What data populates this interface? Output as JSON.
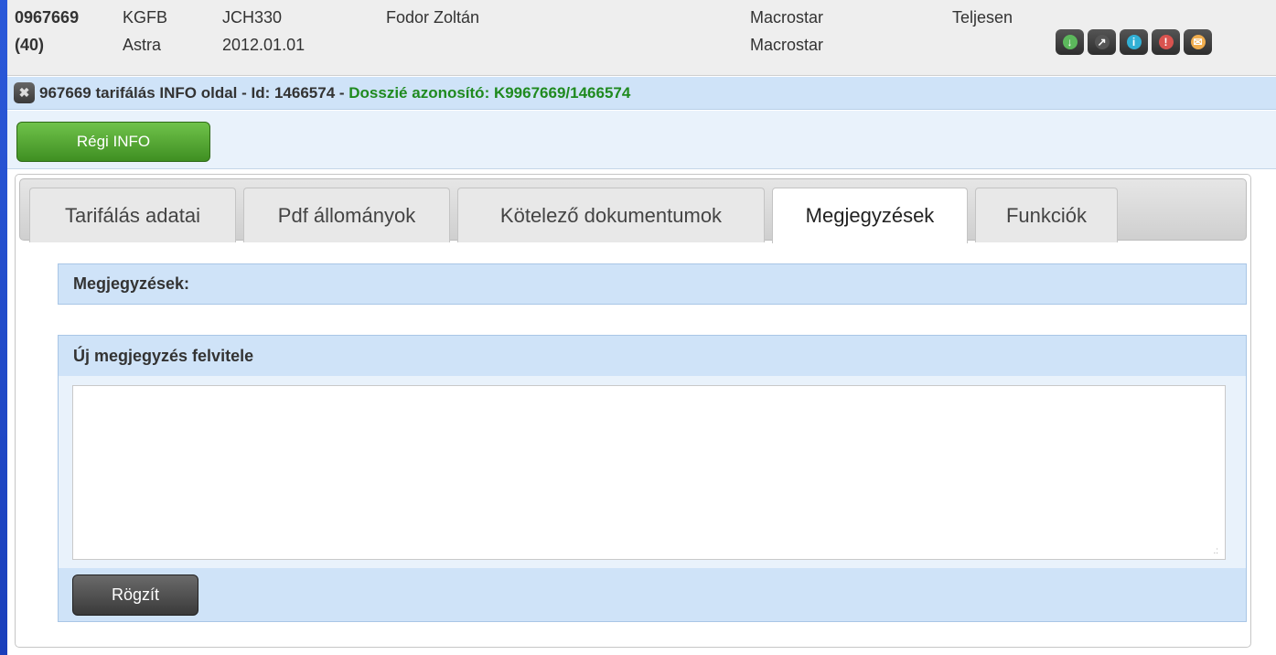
{
  "header": {
    "policy_number": "0967669",
    "policy_count": "(40)",
    "product": "KGFB",
    "vehicle_make": "Astra",
    "plate": "JCH330",
    "date": "2012.01.01",
    "client_name": "Fodor Zoltán",
    "agent_1": "Macrostar",
    "agent_2": "Macrostar",
    "status": "Teljesen",
    "icons": [
      {
        "name": "download-icon",
        "glyph": "↓",
        "color": "#5cb85c"
      },
      {
        "name": "external-link-icon",
        "glyph": "↗",
        "color": "#555555"
      },
      {
        "name": "info-icon",
        "glyph": "i",
        "color": "#31b0d5"
      },
      {
        "name": "alert-icon",
        "glyph": "!",
        "color": "#d9534f"
      },
      {
        "name": "mail-icon",
        "glyph": "✉",
        "color": "#f0ad4e"
      }
    ]
  },
  "titlebar": {
    "close_glyph": "✖",
    "title": "967669 tarifálás INFO oldal - Id: 1466574 - ",
    "dossier": "Dosszié azonosító: K9967669/1466574"
  },
  "actions": {
    "regi_info_label": "Régi INFO"
  },
  "tabs": [
    {
      "label": "Tarifálás adatai"
    },
    {
      "label": "Pdf állományok"
    },
    {
      "label": "Kötelező dokumentumok"
    },
    {
      "label": "Megjegyzések",
      "active": true
    },
    {
      "label": "Funkciók"
    }
  ],
  "notes": {
    "section_title": "Megjegyzések:",
    "new_note_title": "Új megjegyzés felvitele",
    "textarea_value": "",
    "submit_label": "Rögzít"
  }
}
